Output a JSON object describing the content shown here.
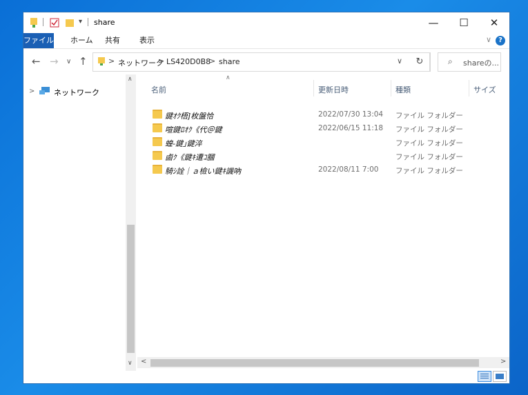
{
  "window": {
    "title": "share"
  },
  "ribbon": {
    "tabs": [
      "ファイル",
      "ホーム",
      "共有",
      "表示"
    ]
  },
  "address": {
    "crumbs": [
      "ネットワーク",
      "LS420D0B8",
      "share"
    ],
    "separator": ">"
  },
  "search": {
    "placeholder": "shareの..."
  },
  "nav_pane": {
    "items": [
      {
        "label": "ネットワーク"
      }
    ]
  },
  "columns": [
    "名前",
    "更新日時",
    "種類",
    "サイズ"
  ],
  "files": [
    {
      "name": "鍵ｵｸ梧]枚盤恰",
      "date": "2022/07/30 13:04",
      "type": "ファイル フォルダー"
    },
    {
      "name": "喧鍵ﾛｵｸ《代＠鍵",
      "date": "2022/06/15 11:18",
      "type": "ファイル フォルダー"
    },
    {
      "name": "蝗-鍵｣鍵淬",
      "date": "",
      "type": "ファイル フォルダー"
    },
    {
      "name": "鹵ｸ《鍵ｷ遭ｺ膕",
      "date": "",
      "type": "ファイル フォルダー"
    },
    {
      "name": "騎ｼ詮｜ａ檢い鍵ｷ譏吶",
      "date": "2022/08/11 7:00",
      "type": "ファイル フォルダー"
    }
  ],
  "icons": {
    "folder": "folder-icon",
    "network": "network-icon"
  },
  "colors": {
    "file_tab": "#1a5fb4",
    "folder": "#f5c94e",
    "desktop": "#0a6fd6"
  }
}
